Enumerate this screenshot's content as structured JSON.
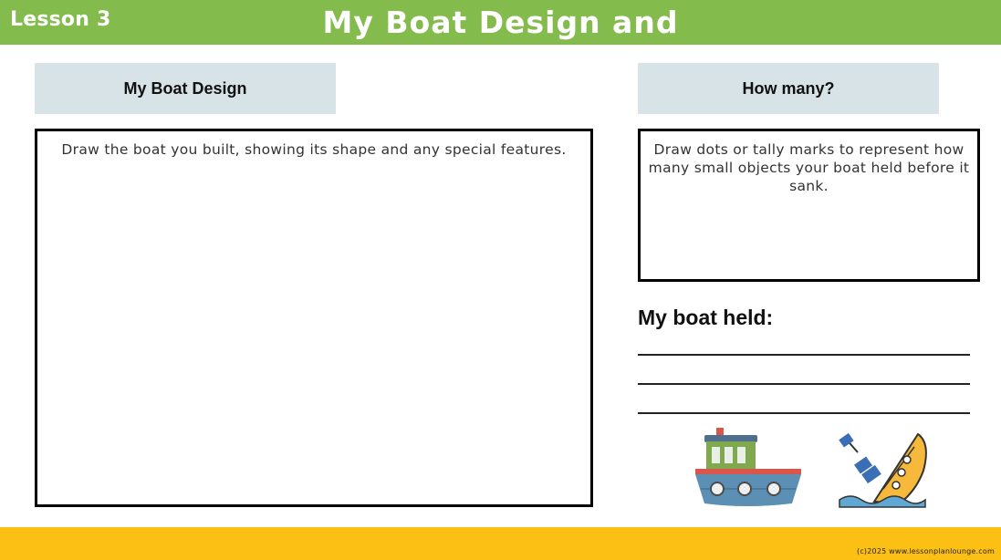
{
  "header": {
    "lesson": "Lesson 3",
    "title": "My Boat Design and Test!"
  },
  "design": {
    "heading": "My Boat Design",
    "instruction": "Draw the boat you built, showing its shape and any special features."
  },
  "count": {
    "heading": "How many?",
    "instruction": "Draw dots or tally marks to represent how many small objects your boat held before it sank."
  },
  "held": {
    "heading": "My boat held:"
  },
  "images": {
    "floating_boat": "floating-boat-icon",
    "sinking_boat": "sinking-boat-icon"
  },
  "footer": {
    "copyright": "(c)2025 www.lessonplanlounge.com"
  },
  "colors": {
    "header_bg": "#84bb4d",
    "label_bg": "#d8e3e8",
    "footer_bg": "#fcc014"
  }
}
